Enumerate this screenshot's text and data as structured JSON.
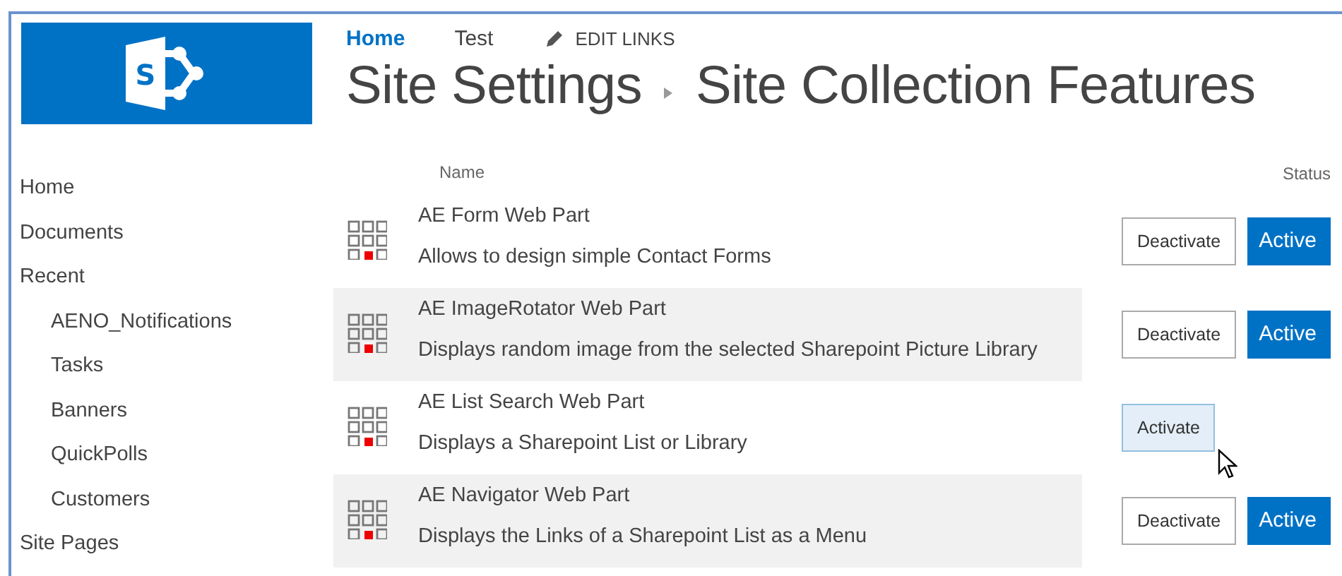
{
  "logo": {
    "letter": "S"
  },
  "top_nav": [
    {
      "label": "Home",
      "selected": true
    },
    {
      "label": "Test",
      "selected": false
    }
  ],
  "edit_links": "EDIT LINKS",
  "breadcrumb": [
    "Site Settings",
    "Site Collection Features"
  ],
  "sidebar": {
    "items": [
      {
        "label": "Home"
      },
      {
        "label": "Documents"
      },
      {
        "label": "Recent",
        "children": [
          {
            "label": "AENO_Notifications"
          },
          {
            "label": "Tasks"
          },
          {
            "label": "Banners"
          },
          {
            "label": "QuickPolls"
          },
          {
            "label": "Customers"
          }
        ]
      },
      {
        "label": "Site Pages"
      }
    ]
  },
  "table": {
    "columns": [
      "Name",
      "Status"
    ],
    "rows": [
      {
        "name": "AE Form Web Part",
        "description": "Allows to design simple Contact Forms",
        "button": "Deactivate",
        "status": "Active",
        "hovered": false
      },
      {
        "name": "AE ImageRotator Web Part",
        "description": "Displays random image from the selected Sharepoint Picture Library",
        "button": "Deactivate",
        "status": "Active",
        "hovered": false
      },
      {
        "name": "AE List Search Web Part",
        "description": "Displays a Sharepoint List or Library",
        "button": "Activate",
        "hovered": true
      },
      {
        "name": "AE Navigator Web Part",
        "description": "Displays the Links of a Sharepoint List as a Menu",
        "button": "Deactivate",
        "status": "Active",
        "hovered": false
      }
    ]
  }
}
